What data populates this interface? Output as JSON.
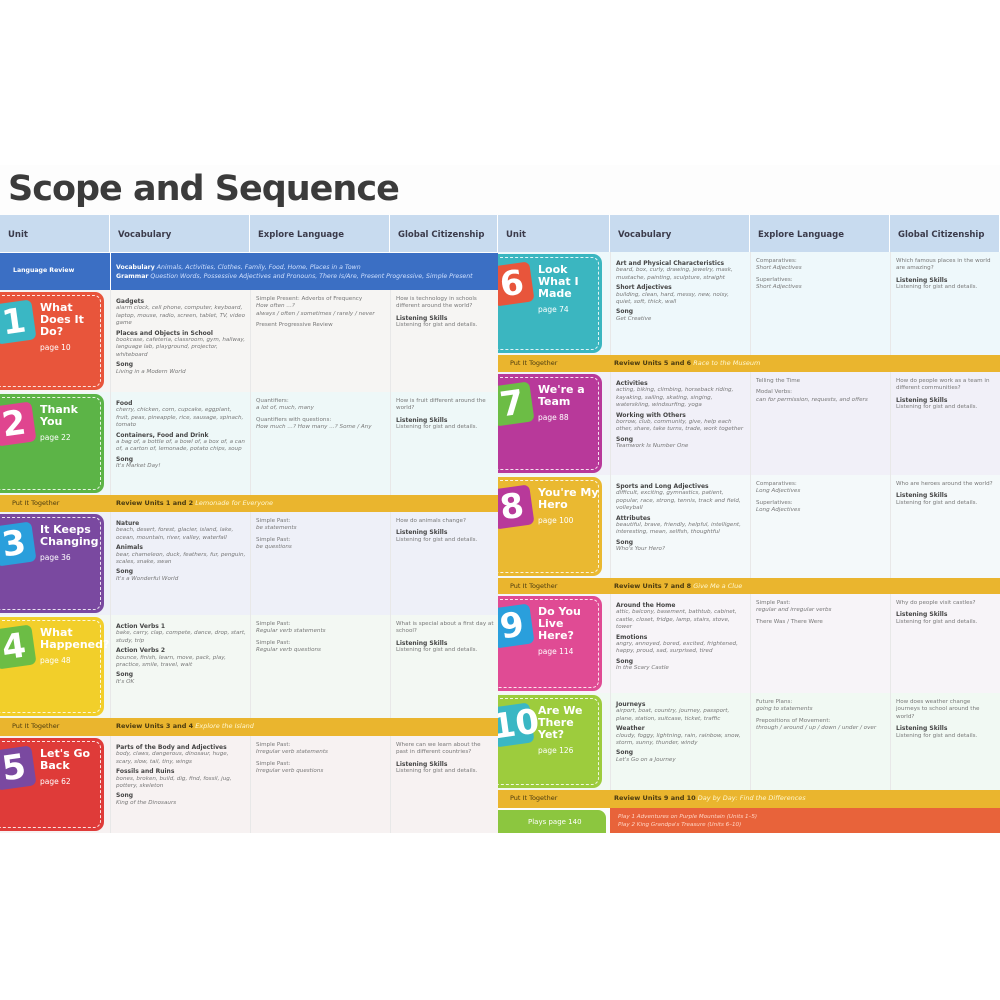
{
  "title": "Scope and Sequence",
  "headers": [
    "Unit",
    "Vocabulary",
    "Explore Language",
    "Global Citizenship"
  ],
  "language_review": {
    "label": "Language Review",
    "vocab_label": "Vocabulary",
    "vocab": "Animals, Activities, Clothes, Family, Food, Home, Places in a Town",
    "grammar_label": "Grammar",
    "grammar": "Question Words, Possessive Adjectives and Pronouns, There Is/Are, Present Progressive, Simple Present"
  },
  "colors": {
    "header": "#c8dbef",
    "put_it_together": "#eab52e",
    "language_review": "#3b6fc4"
  },
  "units": [
    {
      "num": "1",
      "title": "What Does It Do?",
      "page": "page 10",
      "color": "#e8553b",
      "badge": "#3ab7c4",
      "bg": "#f6f5f3",
      "vocab": [
        [
          "Gadgets",
          "alarm clock, cell phone, computer, keyboard, laptop, mouse, radio, screen, tablet, TV, video game"
        ],
        [
          "Places and Objects in School",
          "bookcase, cafeteria, classroom, gym, hallway, language lab, playground, projector, whiteboard"
        ],
        [
          "Song",
          "Living in a Modern World"
        ]
      ],
      "explore": [
        [
          "",
          "Simple Present: Adverbs of Frequency",
          "How often …?",
          "always / often / sometimes / rarely / never"
        ],
        [
          "",
          "Present Progressive Review"
        ]
      ],
      "global": [
        "How is technology in schools different around the world?",
        "Listening Skills",
        "Listening for gist and details."
      ]
    },
    {
      "num": "2",
      "title": "Thank You",
      "page": "page 22",
      "color": "#5cb447",
      "badge": "#e0458f",
      "bg": "#eef8f8",
      "vocab": [
        [
          "Food",
          "cherry, chicken, corn, cupcake, eggplant, fruit, peas, pineapple, rice, sausage, spinach, tomato"
        ],
        [
          "Containers, Food and Drink",
          "a bag of, a bottle of, a bowl of, a box of, a can of, a carton of, lemonade, potato chips, soup"
        ],
        [
          "Song",
          "It's Market Day!"
        ]
      ],
      "explore": [
        [
          "",
          "Quantifiers:",
          "a lot of, much, many"
        ],
        [
          "",
          "Quantifiers with questions:",
          "How much …? How many …? Some / Any"
        ]
      ],
      "global": [
        "How is fruit different around the world?",
        "Listening Skills",
        "Listening for gist and details."
      ]
    },
    {
      "num": "3",
      "title": "It Keeps Changing",
      "page": "page 36",
      "color": "#7a49a0",
      "badge": "#2a9fdc",
      "bg": "#eef0f8",
      "vocab": [
        [
          "Nature",
          "beach, desert, forest, glacier, island, lake, ocean, mountain, river, valley, waterfall"
        ],
        [
          "Animals",
          "bear, chameleon, duck, feathers, fur, penguin, scales, snake, swan"
        ],
        [
          "Song",
          "It's a Wonderful World"
        ]
      ],
      "explore": [
        [
          "",
          "Simple Past:",
          "be statements"
        ],
        [
          "",
          "Simple Past:",
          "be questions"
        ]
      ],
      "global": [
        "How do animals change?",
        "Listening Skills",
        "Listening for gist and details."
      ]
    },
    {
      "num": "4",
      "title": "What Happened?",
      "page": "page 48",
      "color": "#f2cf2a",
      "badge": "#6cbd45",
      "bg": "#f3f8f3",
      "vocab": [
        [
          "Action Verbs 1",
          "bake, carry, clap, compete, dance, drop, start, study, trip"
        ],
        [
          "Action Verbs 2",
          "bounce, finish, learn, move, pack, play, practice, smile, travel, wait"
        ],
        [
          "Song",
          "It's OK"
        ]
      ],
      "explore": [
        [
          "",
          "Simple Past:",
          "Regular verb statements"
        ],
        [
          "",
          "Simple Past:",
          "Regular verb questions"
        ]
      ],
      "global": [
        "What is special about a first day at school?",
        "Listening Skills",
        "Listening for gist and details."
      ]
    },
    {
      "num": "5",
      "title": "Let's Go Back",
      "page": "page 62",
      "color": "#df3b39",
      "badge": "#7a49a0",
      "bg": "#f7f2f2",
      "vocab": [
        [
          "Parts of the Body and Adjectives",
          "body, claws, dangerous, dinosaur, huge, scary, slow, tail, tiny, wings"
        ],
        [
          "Fossils and Ruins",
          "bones, broken, build, dig, find, fossil, jug, pottery, skeleton"
        ],
        [
          "Song",
          "King of the Dinosaurs"
        ]
      ],
      "explore": [
        [
          "",
          "Simple Past:",
          "Irregular verb statements"
        ],
        [
          "",
          "Simple Past:",
          "Irregular verb questions"
        ]
      ],
      "global": [
        "Where can we learn about the past in different countries?",
        "Listening Skills",
        "Listening for gist and details."
      ]
    },
    {
      "num": "6",
      "title": "Look What I Made",
      "page": "page 74",
      "color": "#3bb6c0",
      "badge": "#e8553b",
      "bg": "#eef8fb",
      "vocab": [
        [
          "Art and Physical Characteristics",
          "beard, box, curly, drawing, jewelry, mask, mustache, painting, sculpture, straight"
        ],
        [
          "Short Adjectives",
          "building, clean, hard, messy, new, noisy, quiet, soft, thick, wall"
        ],
        [
          "Song",
          "Get Creative"
        ]
      ],
      "explore": [
        [
          "",
          "Comparatives:",
          "Short Adjectives"
        ],
        [
          "",
          "Superlatives:",
          "Short Adjectives"
        ]
      ],
      "global": [
        "Which famous places in the world are amazing?",
        "Listening Skills",
        "Listening for gist and details."
      ]
    },
    {
      "num": "7",
      "title": "We're a Team",
      "page": "page 88",
      "color": "#b8399a",
      "badge": "#6cbd45",
      "bg": "#f1f0f8",
      "vocab": [
        [
          "Activities",
          "acting, biking, climbing, horseback riding, kayaking, sailing, skating, singing, waterskiing, windsurfing, yoga"
        ],
        [
          "Working with Others",
          "borrow, club, community, give, help each other, share, take turns, trade, work together"
        ],
        [
          "Song",
          "Teamwork Is Number One"
        ]
      ],
      "explore": [
        [
          "",
          "Telling the Time"
        ],
        [
          "",
          "Modal Verbs:",
          "can for permission, requests, and offers"
        ]
      ],
      "global": [
        "How do people work as a team in different communities?",
        "Listening Skills",
        "Listening for gist and details."
      ]
    },
    {
      "num": "8",
      "title": "You're My Hero",
      "page": "page 100",
      "color": "#eab931",
      "badge": "#b8399a",
      "bg": "#f4f9fa",
      "vocab": [
        [
          "Sports and Long Adjectives",
          "difficult, exciting, gymnastics, patient, popular, race, strong, tennis, track and field, volleyball"
        ],
        [
          "Attributes",
          "beautiful, brave, friendly, helpful, intelligent, interesting, mean, selfish, thoughtful"
        ],
        [
          "Song",
          "Who's Your Hero?"
        ]
      ],
      "explore": [
        [
          "",
          "Comparatives:",
          "Long Adjectives"
        ],
        [
          "",
          "Superlatives:",
          "Long Adjectives"
        ]
      ],
      "global": [
        "Who are heroes around the world?",
        "Listening Skills",
        "Listening for gist and details."
      ]
    },
    {
      "num": "9",
      "title": "Do You Live Here?",
      "page": "page 114",
      "color": "#e04b94",
      "badge": "#2a9fdc",
      "bg": "#f7f4f8",
      "vocab": [
        [
          "Around the Home",
          "attic, balcony, basement, bathtub, cabinet, castle, closet, fridge, lamp, stairs, stove, tower"
        ],
        [
          "Emotions",
          "angry, annoyed, bored, excited, frightened, happy, proud, sad, surprised, tired"
        ],
        [
          "Song",
          "In the Scary Castle"
        ]
      ],
      "explore": [
        [
          "",
          "Simple Past:",
          "regular and irregular verbs"
        ],
        [
          "",
          "There Was / There Were"
        ]
      ],
      "global": [
        "Why do people visit castles?",
        "Listening Skills",
        "Listening for gist and details."
      ]
    },
    {
      "num": "10",
      "title": "Are We There Yet?",
      "page": "page 126",
      "color": "#9dcc3d",
      "badge": "#3ab7c4",
      "bg": "#f1f9f3",
      "vocab": [
        [
          "Journeys",
          "airport, boat, country, journey, passport, plane, station, suitcase, ticket, traffic"
        ],
        [
          "Weather",
          "cloudy, foggy, lightning, rain, rainbow, snow, storm, sunny, thunder, windy"
        ],
        [
          "Song",
          "Let's Go on a Journey"
        ]
      ],
      "explore": [
        [
          "",
          "Future Plans:",
          "going to statements"
        ],
        [
          "",
          "Prepositions of Movement:",
          "through / around / up / down / under / over"
        ]
      ],
      "global": [
        "How does weather change journeys to school around the world?",
        "Listening Skills",
        "Listening for gist and details."
      ]
    }
  ],
  "put_it_together": [
    {
      "label": "Put It Together",
      "review": "Review Units 1 and 2",
      "activity": "Lemonade for Everyone"
    },
    {
      "label": "Put It Together",
      "review": "Review Units 3 and 4",
      "activity": "Explore the Island"
    },
    {
      "label": "Put It Together",
      "review": "Review Units 5 and 6",
      "activity": "Race to the Museum"
    },
    {
      "label": "Put It Together",
      "review": "Review Units 7 and 8",
      "activity": "Give Me a Clue"
    },
    {
      "label": "Put It Together",
      "review": "Review Units 9 and 10",
      "activity": "Day by Day: Find the Differences"
    }
  ],
  "plays": {
    "label": "Plays page 140",
    "play1": "Play 1 Adventures on Purple Mountain (Units 1–5)",
    "play2": "Play 2 King Grandpa's Treasure (Units 6–10)"
  }
}
